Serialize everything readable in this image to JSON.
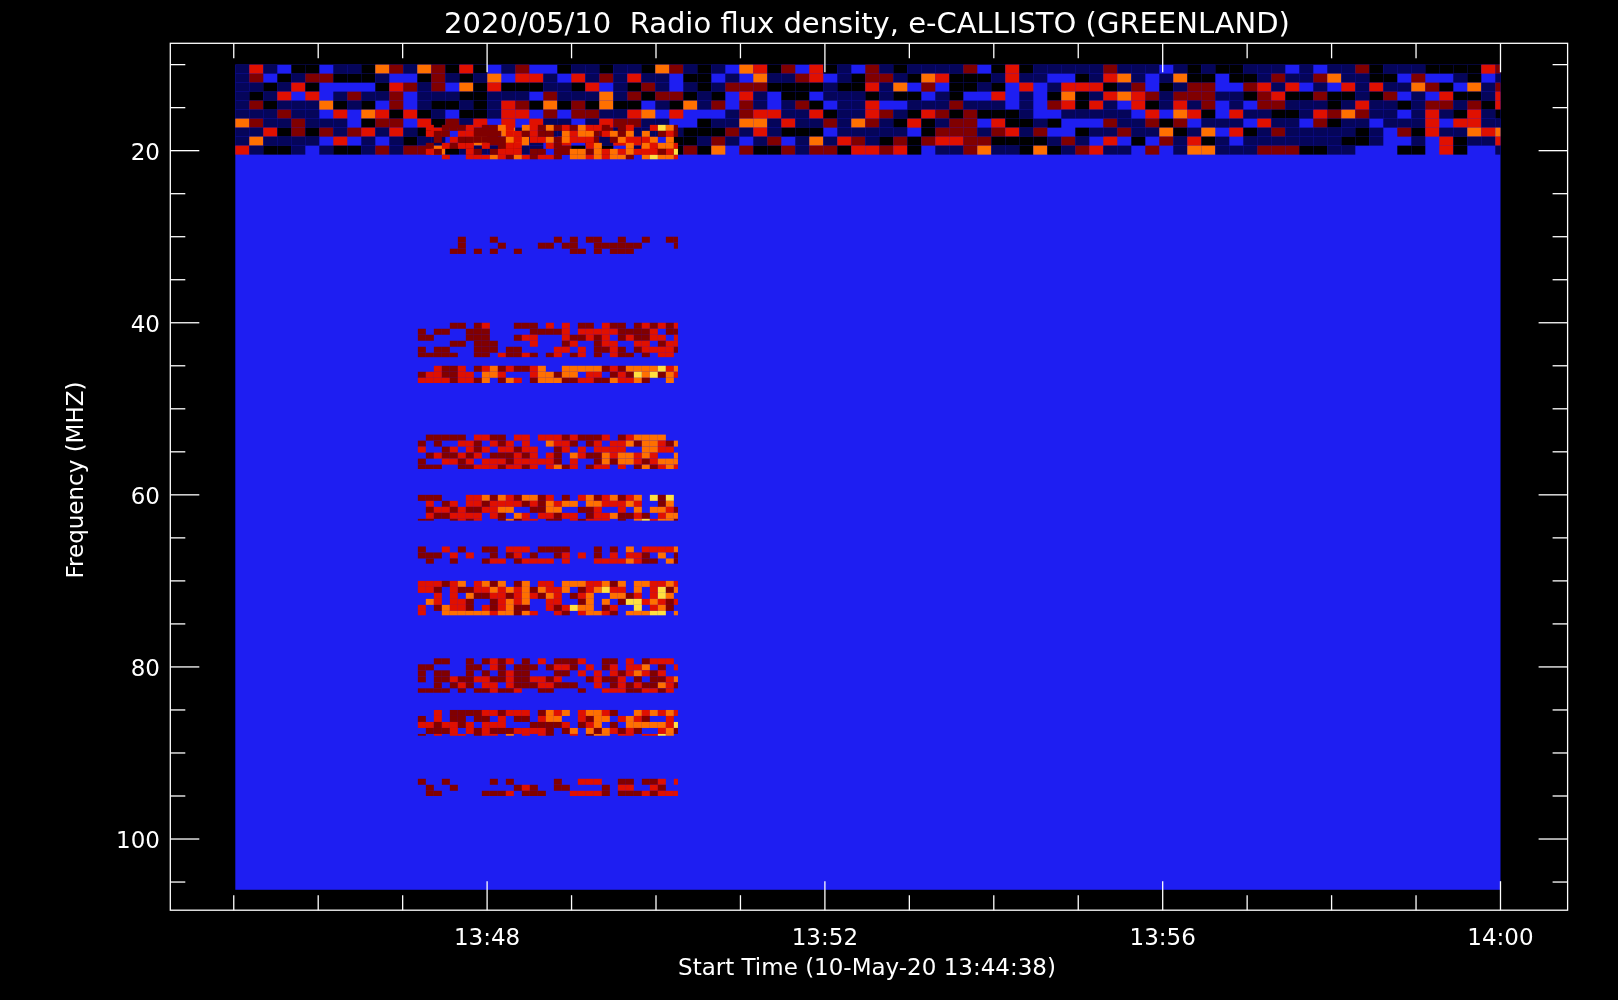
{
  "title": "2020/05/10  Radio flux density, e-CALLISTO (GREENLAND)",
  "y_axis": {
    "label": "Frequency (MHZ)",
    "ticks": [
      "20",
      "40",
      "60",
      "80",
      "100"
    ]
  },
  "x_axis": {
    "label": "Start Time (10-May-20 13:44:38)",
    "ticks": [
      "13:48",
      "13:52",
      "13:56",
      "14:00"
    ]
  }
}
